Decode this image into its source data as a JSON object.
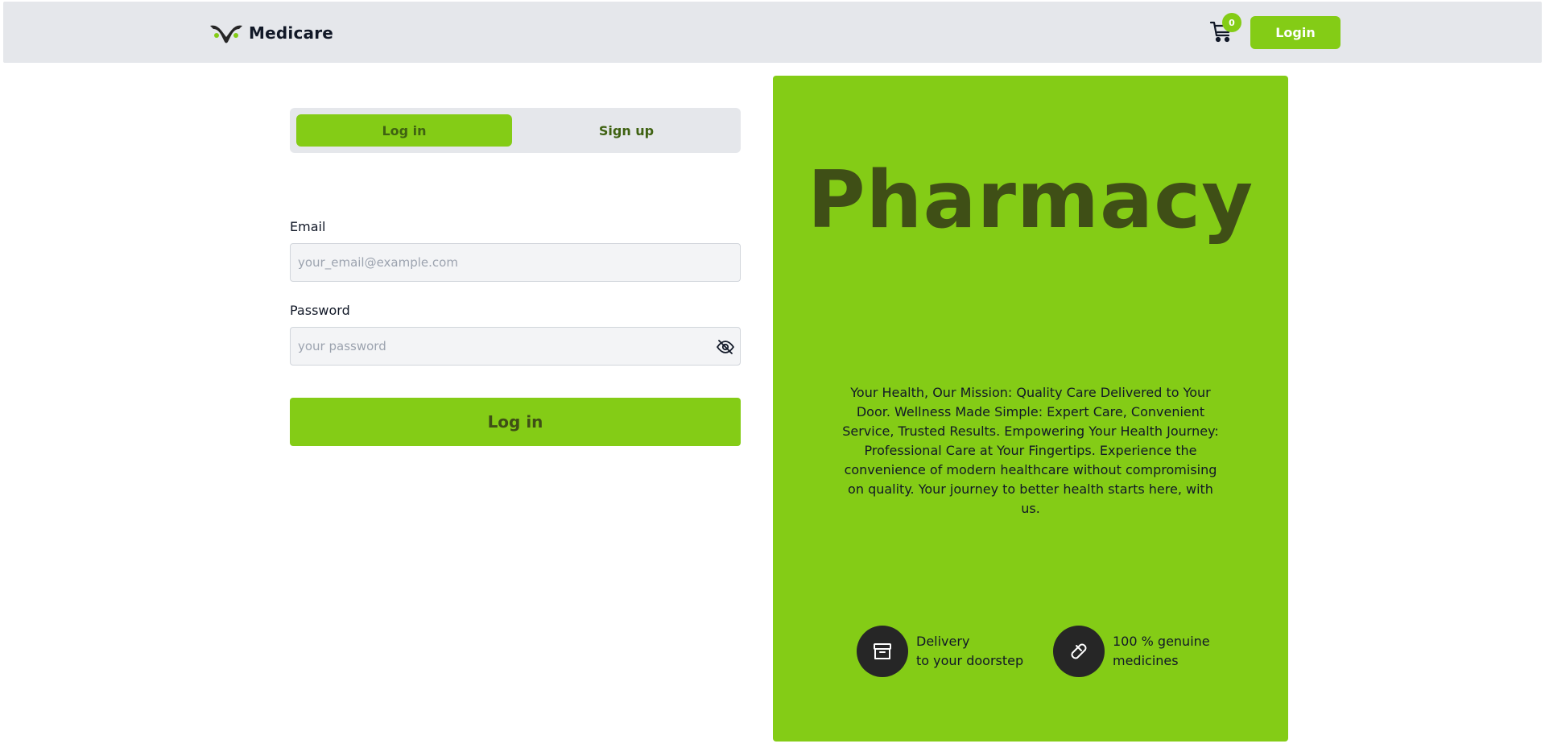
{
  "header": {
    "brand_name": "Medicare",
    "cart_count": "0",
    "login_label": "Login"
  },
  "auth": {
    "tabs": [
      {
        "label": "Log in",
        "active": true
      },
      {
        "label": "Sign up",
        "active": false
      }
    ],
    "email_label": "Email",
    "email_placeholder": "your_email@example.com",
    "password_label": "Password",
    "password_placeholder": "your password",
    "submit_label": "Log in"
  },
  "promo": {
    "title": "Pharmacy",
    "description": "Your Health, Our Mission: Quality Care Delivered to Your Door. Wellness Made Simple: Expert Care, Convenient Service, Trusted Results. Empowering Your Health Journey: Professional Care at Your Fingertips. Experience the convenience of modern healthcare without compromising on quality. Your journey to better health starts here, with us.",
    "features": [
      {
        "icon": "archive-box-icon",
        "line1": "Delivery",
        "line2": "to your doorstep"
      },
      {
        "icon": "pill-icon",
        "line1": "100 % genuine",
        "line2": "medicines"
      }
    ]
  },
  "colors": {
    "accent": "#84cc16",
    "accent_dark_text": "#3f6212",
    "navbar_bg": "#e5e7eb",
    "icon_circle": "#262626"
  }
}
